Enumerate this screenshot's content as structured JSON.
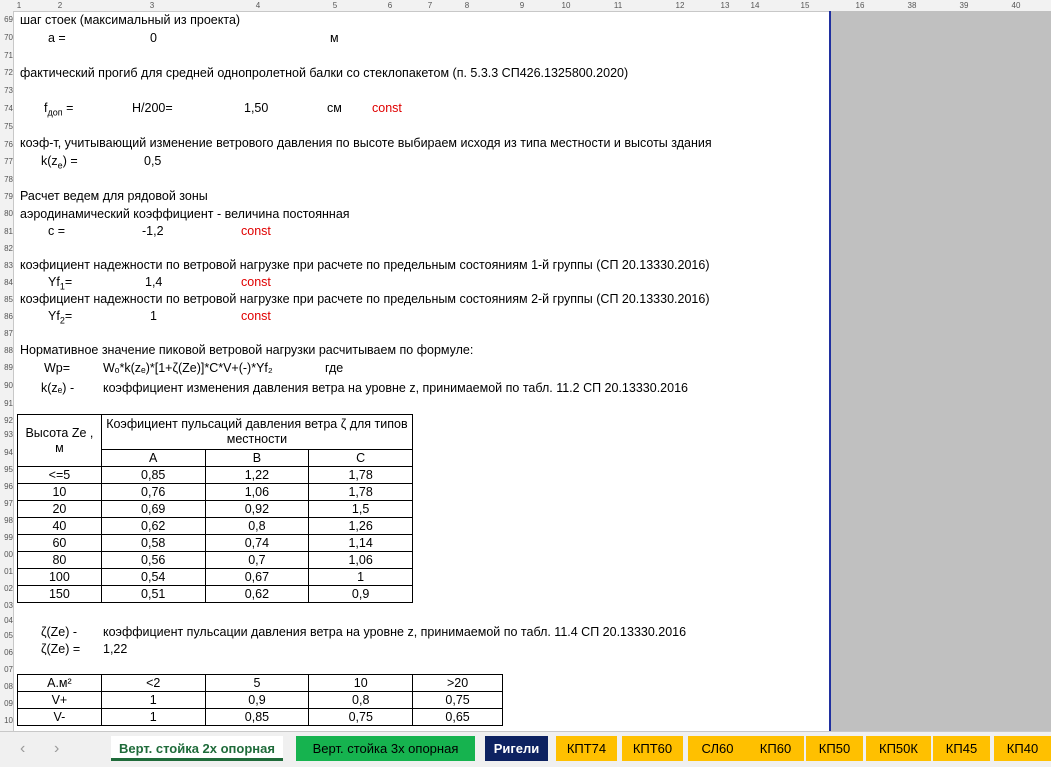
{
  "col_headers": [
    "1",
    "2",
    "3",
    "4",
    "5",
    "6",
    "7",
    "8",
    "9",
    "10",
    "11",
    "12",
    "13",
    "14",
    "15",
    "16",
    "38",
    "39",
    "40"
  ],
  "row_headers": [
    "69",
    "70",
    "71",
    "72",
    "73",
    "74",
    "75",
    "76",
    "77",
    "78",
    "79",
    "80",
    "81",
    "82",
    "83",
    "84",
    "85",
    "86",
    "87",
    "88",
    "89",
    "90",
    "91",
    "92",
    "93",
    "94",
    "95",
    "96",
    "97",
    "98",
    "99",
    "00",
    "01",
    "02",
    "03",
    "04",
    "05",
    "06",
    "07",
    "08",
    "09",
    "10"
  ],
  "text": {
    "r69": "шаг стоек (максимальный из проекта)",
    "r70_label": "а =",
    "r70_value": "0",
    "r70_unit": "м",
    "r72": "фактический прогиб для средней однопролетной балки со стеклопакетом (п. 5.3.3 СП426.1325800.2020)",
    "r74_f": "f",
    "r74_sub": "доп",
    "r74_eq": " =",
    "r74_formula": "H/200=",
    "r74_value": "1,50",
    "r74_unit": "см",
    "r74_const": "const",
    "r76": "коэф-т, учитывающий изменение ветрового давления по высоте выбираем исходя из типа местности и высоты здания",
    "r77_label_a": "k(z",
    "r77_sub": "e",
    "r77_label_b": ") =",
    "r77_value": "0,5",
    "r79": "Расчет ведем для рядовой зоны",
    "r80": "аэродинамический коэффициент - величина постоянная",
    "r81_label": "c =",
    "r81_value": "-1,2",
    "r81_const": "const",
    "r83": "коэфициент надежности по ветровой нагрузке  при расчете по предельным состояниям 1-й группы (СП 20.13330.2016)",
    "r84_label": "Yf",
    "r84_sub": "1",
    "r84_eq": "=",
    "r84_value": "1,4",
    "r84_const": "const",
    "r85": "коэфициент надежности по ветровой нагрузке  при расчете по предельным состояниям 2-й группы (СП 20.13330.2016)",
    "r86_label": "Yf",
    "r86_sub": "2",
    "r86_eq": "=",
    "r86_value": "1",
    "r86_const": "const",
    "r88": "Нормативное значение пиковой ветровой нагрузки расчитываем по формуле:",
    "r89_label": "Wp=",
    "r89_formula": "Wₒ*k(zₑ)*[1+ζ(Ze)]*C*V+(-)*Yf₂",
    "r89_where": "где",
    "r90_label": "k(zₑ) -",
    "r90_text": "коэффициент изменения  давления ветра на уровне z, принимаемой по табл. 11.2  СП 20.13330.2016",
    "r105_label": "ζ(Ze) -",
    "r105_text": "коэффициент пульсации  давления ветра на уровне z, принимаемой по табл. 11.4  СП 20.13330.2016",
    "r106_label": "ζ(Ze) =",
    "r106_value": "1,22"
  },
  "table1": {
    "head_height": "Высота Ze ,\nм",
    "head_coef": "Коэфициент пульсаций давления ветра ζ  для типов местности",
    "cols": [
      "A",
      "B",
      "C"
    ],
    "rows": [
      [
        "<=5",
        "0,85",
        "1,22",
        "1,78"
      ],
      [
        "10",
        "0,76",
        "1,06",
        "1,78"
      ],
      [
        "20",
        "0,69",
        "0,92",
        "1,5"
      ],
      [
        "40",
        "0,62",
        "0,8",
        "1,26"
      ],
      [
        "60",
        "0,58",
        "0,74",
        "1,14"
      ],
      [
        "80",
        "0,56",
        "0,7",
        "1,06"
      ],
      [
        "100",
        "0,54",
        "0,67",
        "1"
      ],
      [
        "150",
        "0,51",
        "0,62",
        "0,9"
      ]
    ]
  },
  "table2": {
    "header": [
      "А.м²",
      "<2",
      "5",
      "10",
      ">20"
    ],
    "rows": [
      [
        "V+",
        "1",
        "0,9",
        "0,8",
        "0,75"
      ],
      [
        "V-",
        "1",
        "0,85",
        "0,75",
        "0,65"
      ]
    ]
  },
  "tabs": {
    "t1": "Верт. стойка 2х опорная",
    "t2": "Верт. стойка 3х опорная",
    "t3": "Ригели",
    "t4": "КПТ74",
    "t5": "КПТ60",
    "t6": "СЛ60",
    "t7": "КП60",
    "t8": "КП50",
    "t9": "КП50К",
    "t10": "КП45",
    "t11": "КП40"
  },
  "nav": {
    "prev": "‹",
    "next": "›"
  },
  "colors": {
    "accent_blue": "#2030a0",
    "const_red": "#e00000",
    "tab_green": "#16b34f",
    "tab_navy": "#0d2261",
    "tab_yellow": "#ffc000"
  }
}
